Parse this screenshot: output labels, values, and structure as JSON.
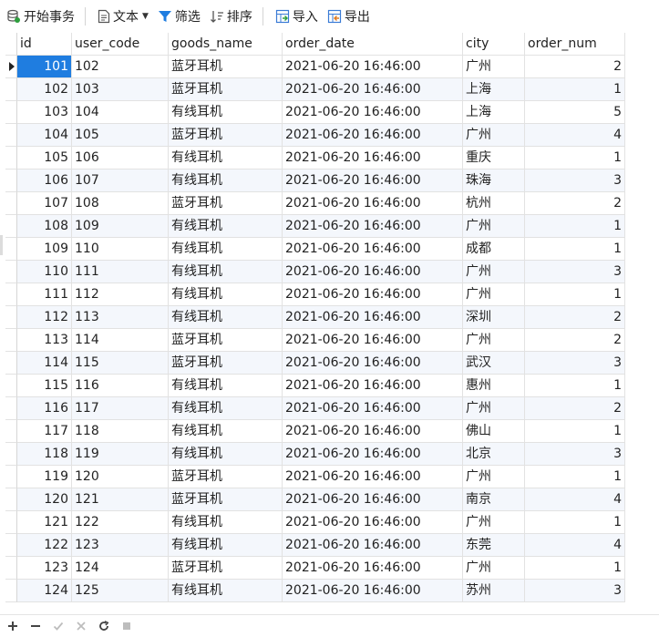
{
  "toolbar": {
    "begin_transaction": "开始事务",
    "text": "文本",
    "filter": "筛选",
    "sort": "排序",
    "import": "导入",
    "export": "导出"
  },
  "table": {
    "columns": [
      "id",
      "user_code",
      "goods_name",
      "order_date",
      "city",
      "order_num"
    ],
    "rows": [
      [
        "101",
        "102",
        "蓝牙耳机",
        "2021-06-20 16:46:00",
        "广州",
        "2"
      ],
      [
        "102",
        "103",
        "蓝牙耳机",
        "2021-06-20 16:46:00",
        "上海",
        "1"
      ],
      [
        "103",
        "104",
        "有线耳机",
        "2021-06-20 16:46:00",
        "上海",
        "5"
      ],
      [
        "104",
        "105",
        "蓝牙耳机",
        "2021-06-20 16:46:00",
        "广州",
        "4"
      ],
      [
        "105",
        "106",
        "有线耳机",
        "2021-06-20 16:46:00",
        "重庆",
        "1"
      ],
      [
        "106",
        "107",
        "有线耳机",
        "2021-06-20 16:46:00",
        "珠海",
        "3"
      ],
      [
        "107",
        "108",
        "蓝牙耳机",
        "2021-06-20 16:46:00",
        "杭州",
        "2"
      ],
      [
        "108",
        "109",
        "有线耳机",
        "2021-06-20 16:46:00",
        "广州",
        "1"
      ],
      [
        "109",
        "110",
        "有线耳机",
        "2021-06-20 16:46:00",
        "成都",
        "1"
      ],
      [
        "110",
        "111",
        "有线耳机",
        "2021-06-20 16:46:00",
        "广州",
        "3"
      ],
      [
        "111",
        "112",
        "有线耳机",
        "2021-06-20 16:46:00",
        "广州",
        "1"
      ],
      [
        "112",
        "113",
        "有线耳机",
        "2021-06-20 16:46:00",
        "深圳",
        "2"
      ],
      [
        "113",
        "114",
        "蓝牙耳机",
        "2021-06-20 16:46:00",
        "广州",
        "2"
      ],
      [
        "114",
        "115",
        "蓝牙耳机",
        "2021-06-20 16:46:00",
        "武汉",
        "3"
      ],
      [
        "115",
        "116",
        "有线耳机",
        "2021-06-20 16:46:00",
        "惠州",
        "1"
      ],
      [
        "116",
        "117",
        "有线耳机",
        "2021-06-20 16:46:00",
        "广州",
        "2"
      ],
      [
        "117",
        "118",
        "有线耳机",
        "2021-06-20 16:46:00",
        "佛山",
        "1"
      ],
      [
        "118",
        "119",
        "有线耳机",
        "2021-06-20 16:46:00",
        "北京",
        "3"
      ],
      [
        "119",
        "120",
        "蓝牙耳机",
        "2021-06-20 16:46:00",
        "广州",
        "1"
      ],
      [
        "120",
        "121",
        "蓝牙耳机",
        "2021-06-20 16:46:00",
        "南京",
        "4"
      ],
      [
        "121",
        "122",
        "有线耳机",
        "2021-06-20 16:46:00",
        "广州",
        "1"
      ],
      [
        "122",
        "123",
        "有线耳机",
        "2021-06-20 16:46:00",
        "东莞",
        "4"
      ],
      [
        "123",
        "124",
        "蓝牙耳机",
        "2021-06-20 16:46:00",
        "广州",
        "1"
      ],
      [
        "124",
        "125",
        "有线耳机",
        "2021-06-20 16:46:00",
        "苏州",
        "3"
      ]
    ]
  },
  "bottombar": {
    "icons": [
      "add-icon",
      "remove-icon",
      "apply-icon",
      "discard-icon",
      "refresh-icon",
      "stop-icon"
    ]
  },
  "colors": {
    "selection": "#1f7de0",
    "alt_row": "#f4f7fc",
    "grid_line": "#e2e2e2"
  }
}
